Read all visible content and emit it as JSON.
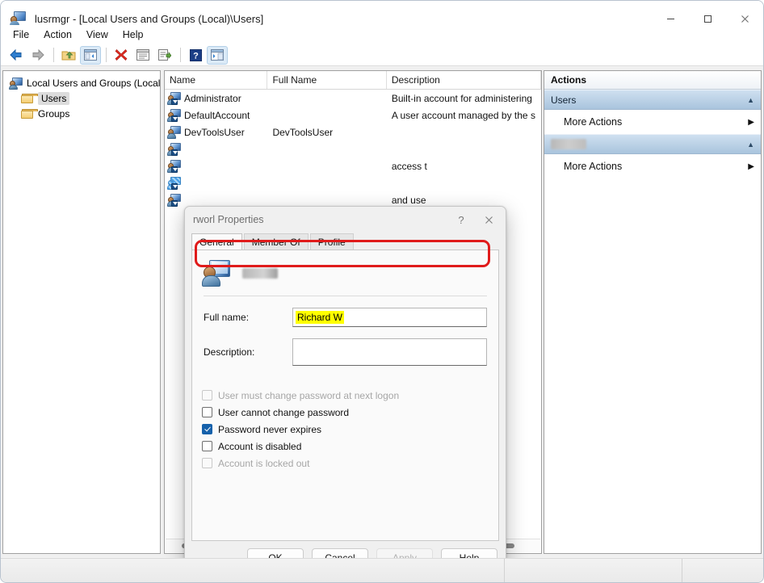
{
  "window": {
    "title": "lusrmgr - [Local Users and Groups (Local)\\Users]",
    "icon": "computer-user-icon",
    "minimize": "–",
    "maximize": "□",
    "close": "✕"
  },
  "menu": {
    "items": [
      "File",
      "Action",
      "View",
      "Help"
    ]
  },
  "toolbar": {
    "buttons": [
      {
        "name": "back-icon",
        "label": "Back"
      },
      {
        "name": "forward-icon",
        "label": "Forward"
      },
      {
        "name": "up-folder-icon",
        "label": "Up One Level"
      },
      {
        "name": "show-tree-icon",
        "label": "Show/Hide Console Tree"
      },
      {
        "name": "delete-icon",
        "label": "Delete"
      },
      {
        "name": "properties-icon",
        "label": "Properties"
      },
      {
        "name": "export-list-icon",
        "label": "Export List"
      },
      {
        "name": "help-icon",
        "label": "Help"
      },
      {
        "name": "show-action-pane-icon",
        "label": "Show/Hide Action Pane"
      }
    ]
  },
  "tree": {
    "root": "Local Users and Groups (Local)",
    "children": [
      {
        "label": "Users",
        "selected": true
      },
      {
        "label": "Groups",
        "selected": false
      }
    ]
  },
  "list": {
    "columns": [
      "Name",
      "Full Name",
      "Description"
    ],
    "rows": [
      {
        "name": "Administrator",
        "full_name": "",
        "description": "Built-in account for administering"
      },
      {
        "name": "DefaultAccount",
        "full_name": "",
        "description": "A user account managed by the s"
      },
      {
        "name": "DevToolsUser",
        "full_name": "DevToolsUser",
        "description": ""
      },
      {
        "name": "",
        "full_name": "",
        "description": ""
      },
      {
        "name": "",
        "full_name": "",
        "description": "access t"
      },
      {
        "name": "",
        "full_name": "",
        "description": ""
      },
      {
        "name": "",
        "full_name": "",
        "description": "and use"
      }
    ]
  },
  "actions": {
    "title": "Actions",
    "sections": [
      {
        "header": "Users",
        "redacted": false,
        "collapse": "▲",
        "items": [
          {
            "label": "More Actions",
            "chevron": "▶"
          }
        ]
      },
      {
        "header": "",
        "redacted": true,
        "collapse": "▲",
        "items": [
          {
            "label": "More Actions",
            "chevron": "▶"
          }
        ]
      }
    ]
  },
  "dialog": {
    "title": "rworl Properties",
    "help_btn": "?",
    "close_btn": "✕",
    "tabs": [
      {
        "label": "General",
        "active": true
      },
      {
        "label": "Member Of",
        "active": false
      },
      {
        "label": "Profile",
        "active": false
      }
    ],
    "account_icon": "user-computer-icon",
    "username_redacted": true,
    "fields": [
      {
        "label": "Full name:",
        "value": "Richard W",
        "highlighted": true
      },
      {
        "label": "Description:",
        "value": "",
        "highlighted": false
      }
    ],
    "checkboxes": [
      {
        "label": "User must change password at next logon",
        "checked": false,
        "disabled": true
      },
      {
        "label": "User cannot change password",
        "checked": false,
        "disabled": false
      },
      {
        "label": "Password never expires",
        "checked": true,
        "disabled": false
      },
      {
        "label": "Account is disabled",
        "checked": false,
        "disabled": false
      },
      {
        "label": "Account is locked out",
        "checked": false,
        "disabled": true
      }
    ],
    "buttons": [
      {
        "label": "OK",
        "disabled": false
      },
      {
        "label": "Cancel",
        "disabled": false
      },
      {
        "label": "Apply",
        "disabled": true
      },
      {
        "label": "Help",
        "disabled": false
      }
    ]
  },
  "annotation": {
    "color": "#e01b1b",
    "target": "Full name:"
  },
  "colors": {
    "highlight_yellow": "#ffff00",
    "annotation_red": "#e01b1b",
    "checkbox_blue": "#1661ab",
    "actions_header": "#a9c4dd"
  }
}
